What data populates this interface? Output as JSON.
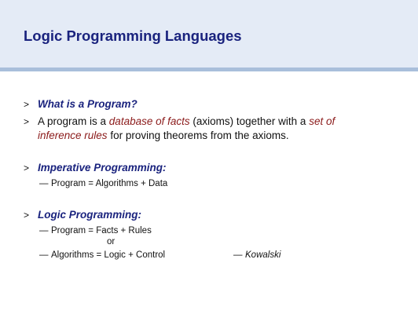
{
  "slide": {
    "title": "Logic Programming Languages"
  },
  "bullets": {
    "marker": ">",
    "q1": "What is a Program?",
    "p1_pre": "A program is a ",
    "p1_em1": "database of facts",
    "p1_mid": " (axioms) together with a ",
    "p1_em2a": "set of",
    "p1_em2b": "inference rules",
    "p1_post": " for proving theorems from the axioms.",
    "q2": "Imperative Programming:",
    "q3": "Logic Programming:"
  },
  "subs": {
    "dash": "—",
    "imperative": "Program = Algorithms + Data",
    "logic1": "Program = Facts + Rules",
    "or": "or",
    "logic2": "Algorithms = Logic + Control",
    "attribution_dash": "—",
    "attribution": "Kowalski"
  }
}
